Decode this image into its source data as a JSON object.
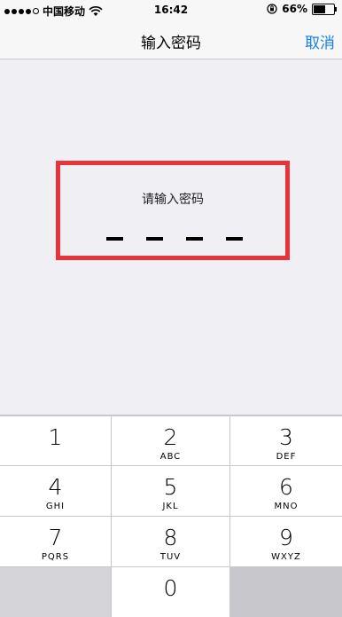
{
  "status_bar": {
    "carrier": "中国移动",
    "time": "16:42",
    "battery": "66%",
    "battery_level": 0.66
  },
  "nav": {
    "title": "输入密码",
    "cancel_label": "取消"
  },
  "password": {
    "prompt": "请输入密码",
    "length": 4
  },
  "keypad": {
    "keys": [
      {
        "num": "1",
        "letters": ""
      },
      {
        "num": "2",
        "letters": "ABC"
      },
      {
        "num": "3",
        "letters": "DEF"
      },
      {
        "num": "4",
        "letters": "GHI"
      },
      {
        "num": "5",
        "letters": "JKL"
      },
      {
        "num": "6",
        "letters": "MNO"
      },
      {
        "num": "7",
        "letters": "PQRS"
      },
      {
        "num": "8",
        "letters": "TUV"
      },
      {
        "num": "9",
        "letters": "WXYZ"
      },
      {
        "num": "",
        "letters": ""
      },
      {
        "num": "0",
        "letters": ""
      }
    ]
  }
}
